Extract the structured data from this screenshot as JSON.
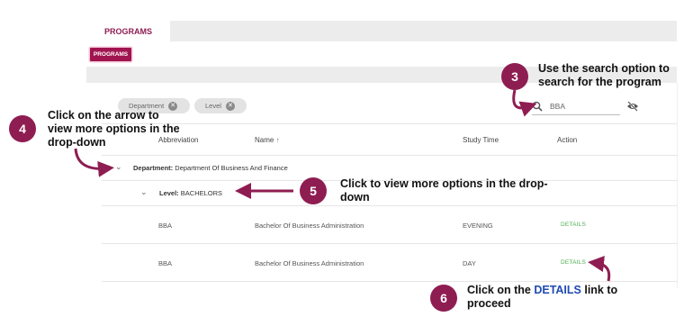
{
  "tabs": {
    "active_label": "PROGRAMS"
  },
  "subnav": {
    "button_label": "PROGRAMS"
  },
  "filters": {
    "chips": [
      {
        "label": "Department"
      },
      {
        "label": "Level"
      }
    ]
  },
  "search": {
    "value": "BBA"
  },
  "table": {
    "columns": {
      "abbreviation": "Abbreviation",
      "name": "Name",
      "name_sort_glyph": "↑",
      "study_time": "Study Time",
      "action": "Action"
    },
    "group_department": {
      "key": "Department:",
      "value": "Department Of Business And Finance"
    },
    "group_level": {
      "key": "Level:",
      "value": "BACHELORS"
    },
    "rows": [
      {
        "abbreviation": "BBA",
        "name": "Bachelor Of Business Administration",
        "study_time": "EVENING",
        "action": "DETAILS"
      },
      {
        "abbreviation": "BBA",
        "name": "Bachelor Of Business Administration",
        "study_time": "DAY",
        "action": "DETAILS"
      }
    ]
  },
  "annotations": {
    "step3": {
      "number": "3",
      "text": "Use the search option to search for the program"
    },
    "step4": {
      "number": "4",
      "text": "Click on the arrow to view more options in the drop-down"
    },
    "step5": {
      "number": "5",
      "text": "Click  to view more options in the drop-down"
    },
    "step6": {
      "number": "6",
      "text_before": "Click  on the ",
      "text_link": "DETAILS",
      "text_after": " link to proceed"
    }
  },
  "colors": {
    "brand": "#8e1d52",
    "details_link": "#4caf50",
    "annotation_highlight": "#1f4bb3"
  },
  "icons": [
    "close-icon",
    "search-icon",
    "eye-off-icon",
    "chevron-down-icon",
    "sort-arrow-icon"
  ]
}
